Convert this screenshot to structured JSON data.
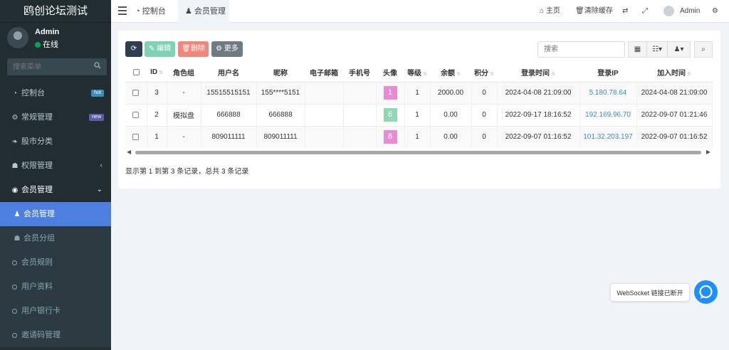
{
  "sidebar": {
    "brand": "鸥创论坛测试",
    "user": {
      "name": "Admin",
      "status": "在线"
    },
    "search_placeholder": "搜索菜单",
    "menu": [
      {
        "label": "控制台",
        "badge": "hot",
        "badge_color": "#3c8dbc"
      },
      {
        "label": "常规管理",
        "badge": "new",
        "badge_color": "#605ca8"
      },
      {
        "label": "股市分类"
      },
      {
        "label": "权限管理"
      },
      {
        "label": "会员管理"
      }
    ],
    "submenu": [
      {
        "label": "会员管理"
      },
      {
        "label": "会员分组"
      },
      {
        "label": "会员规则"
      },
      {
        "label": "用户资料"
      },
      {
        "label": "用户银行卡"
      },
      {
        "label": "邀请码管理"
      }
    ]
  },
  "header": {
    "tabs": [
      {
        "label": "控制台"
      },
      {
        "label": "会员管理"
      }
    ],
    "home": "主页",
    "clear_cache": "清除缓存",
    "user": "Admin"
  },
  "toolbar": {
    "edit": "编辑",
    "delete": "删除",
    "more": "更多",
    "search_placeholder": "搜索",
    "colors": {
      "refresh": "#2c3e50",
      "edit": "#7fd3b4",
      "delete": "#f2867b",
      "more": "#6e7b84"
    }
  },
  "table": {
    "columns": [
      "ID",
      "角色组",
      "用户名",
      "昵称",
      "电子邮箱",
      "手机号",
      "头像",
      "等级",
      "余额",
      "积分",
      "登录时间",
      "登录IP",
      "加入时间"
    ],
    "rows": [
      {
        "id": "3",
        "group": "-",
        "username": "15515515151",
        "nickname": "155****5151",
        "email": "",
        "mobile": "",
        "avatar": "1",
        "avatar_color": "#e98ad4",
        "level": "1",
        "balance": "2000.00",
        "score": "0",
        "login_time": "2024-04-08 21:09:00",
        "login_ip": "5.180.78.64",
        "join_time": "2024-04-08 21:09:00"
      },
      {
        "id": "2",
        "group": "模拟盘",
        "username": "666888",
        "nickname": "666888",
        "email": "",
        "mobile": "",
        "avatar": "6",
        "avatar_color": "#8ed8b5",
        "level": "1",
        "balance": "0.00",
        "score": "0",
        "login_time": "2022-09-17 18:16:52",
        "login_ip": "192.169.96.70",
        "join_time": "2022-09-07 01:21:46"
      },
      {
        "id": "1",
        "group": "-",
        "username": "809011111",
        "nickname": "809011111",
        "email": "",
        "mobile": "",
        "avatar": "8",
        "avatar_color": "#e98ad4",
        "level": "1",
        "balance": "0.00",
        "score": "0",
        "login_time": "2022-09-07 01:16:52",
        "login_ip": "101.32.203.197",
        "join_time": "2022-09-07 01:16:52"
      }
    ],
    "summary": "显示第 1 到第 3 条记录，总共 3 条记录"
  },
  "websocket": {
    "status_text": "WebSocket 链接已断开"
  }
}
